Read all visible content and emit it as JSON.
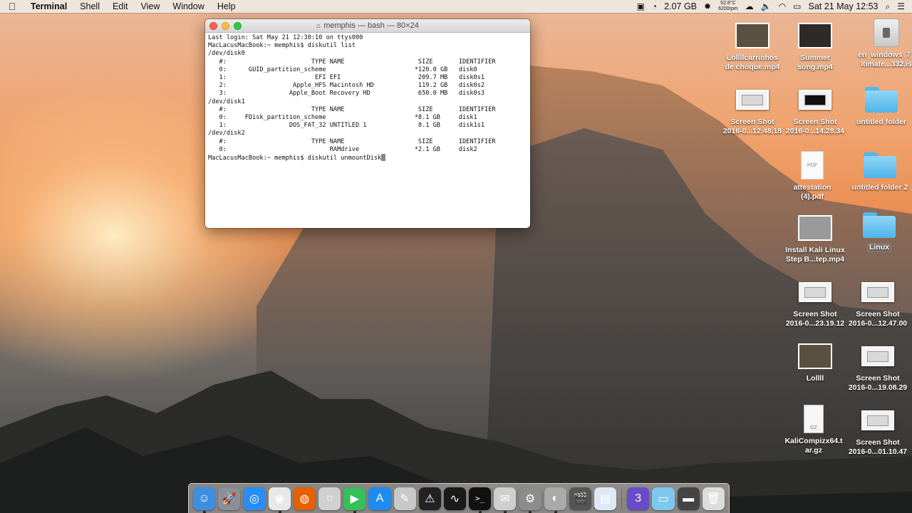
{
  "menubar": {
    "apple_icon": "apple-logo-icon",
    "app_name": "Terminal",
    "items": [
      "Shell",
      "Edit",
      "View",
      "Window",
      "Help"
    ],
    "memory": "2.07 GB",
    "temp_top": "52.8°C",
    "temp_bottom": "6200rpm",
    "date_time": "Sat 21 May  12:53"
  },
  "terminal": {
    "title": "memphis — bash — 80×24",
    "lines": [
      "Last login: Sat May 21 12:30:10 on ttys000",
      "MacLacusMacBook:~ memphis$ diskutil list",
      "/dev/disk0",
      "   #:                       TYPE NAME                    SIZE       IDENTIFIER",
      "   0:      GUID_partition_scheme                        *120.0 GB   disk0",
      "   1:                        EFI EFI                     209.7 MB   disk0s1",
      "   2:                  Apple_HFS Macintosh HD            119.2 GB   disk0s2",
      "   3:                 Apple_Boot Recovery HD             650.0 MB   disk0s3",
      "/dev/disk1",
      "   #:                       TYPE NAME                    SIZE       IDENTIFIER",
      "   0:     FDisk_partition_scheme                        *8.1 GB     disk1",
      "   1:                 DOS_FAT_32 UNTITLED 1              8.1 GB     disk1s1",
      "/dev/disk2",
      "   #:                       TYPE NAME                    SIZE       IDENTIFIER",
      "   0:                            RAMdrive               *2.1 GB     disk2"
    ],
    "prompt_line": "MacLacusMacBook:~ memphis$ diskutil unmountDisk"
  },
  "desktop_icons": [
    {
      "label": "Lollllcarrinhos\nde choque.mp4",
      "kind": "video"
    },
    {
      "label": "Summer\nsong.mp4",
      "kind": "video-dark"
    },
    {
      "label": "en_windows_7_\nltimate...332.is",
      "kind": "disk"
    },
    {
      "label": "Screen Shot\n2016-0...12.48.18",
      "kind": "shot"
    },
    {
      "label": "Screen Shot\n2016-0...14.28.34",
      "kind": "shot-dark"
    },
    {
      "label": "untitled folder",
      "kind": "folder"
    },
    {
      "label": "attestation\n(4).pdf",
      "kind": "pdf"
    },
    {
      "label": "untitled folder 2",
      "kind": "folder"
    },
    {
      "label": "Install Kali Linux\nStep B...tep.mp4",
      "kind": "video-dark"
    },
    {
      "label": "Linux",
      "kind": "folder"
    },
    {
      "label": "Screen Shot\n2016-0...23.19.12",
      "kind": "shot"
    },
    {
      "label": "Screen Shot\n2016-0...12.47.00",
      "kind": "shot"
    },
    {
      "label": "Lollll",
      "kind": "video"
    },
    {
      "label": "Screen Shot\n2016-0...19.08.29",
      "kind": "shot"
    },
    {
      "label": "KaliCompizx64.t\nar.gz",
      "kind": "gz"
    },
    {
      "label": "Screen Shot\n2016-0...01.10.47",
      "kind": "shot"
    }
  ],
  "pdf_badge": "PDF",
  "gz_badge": "GZ",
  "dock": {
    "apps": [
      {
        "name": "finder-icon",
        "color": "#3d8fe0",
        "glyph": "☺"
      },
      {
        "name": "launchpad-icon",
        "color": "#8a8f98",
        "glyph": "🚀"
      },
      {
        "name": "safari-icon",
        "color": "#2a8df2",
        "glyph": "◎"
      },
      {
        "name": "chrome-icon",
        "color": "#e8e8e8",
        "glyph": "◉"
      },
      {
        "name": "firefox-icon",
        "color": "#e66000",
        "glyph": "◍"
      },
      {
        "name": "opera-icon",
        "color": "#d0d0d0",
        "glyph": "○"
      },
      {
        "name": "facetime-icon",
        "color": "#36c05a",
        "glyph": "▶"
      },
      {
        "name": "app-store-icon",
        "color": "#1e8cef",
        "glyph": "A"
      },
      {
        "name": "script-editor-icon",
        "color": "#c8c8c8",
        "glyph": "✎"
      },
      {
        "name": "console-icon",
        "color": "#222",
        "glyph": "⚠"
      },
      {
        "name": "activity-monitor-icon",
        "color": "#1a1a1a",
        "glyph": "∿"
      },
      {
        "name": "terminal-icon",
        "color": "#111",
        "glyph": ">_"
      },
      {
        "name": "preview-icon",
        "color": "#cfcfcf",
        "glyph": "✉"
      },
      {
        "name": "system-preferences-icon",
        "color": "#8c8c8c",
        "glyph": "⚙"
      },
      {
        "name": "disk-utility-icon",
        "color": "#aaa",
        "glyph": "◐"
      },
      {
        "name": "video-icon",
        "color": "#555",
        "glyph": "🎬"
      },
      {
        "name": "document-icon",
        "color": "#dfe8f5",
        "glyph": "▤"
      },
      {
        "name": "mail-icon",
        "color": "#6a4cc9",
        "glyph": "3"
      },
      {
        "name": "downloads-folder-icon",
        "color": "#7ec8ef",
        "glyph": "▭"
      },
      {
        "name": "screen-icon",
        "color": "#444",
        "glyph": "▬"
      },
      {
        "name": "trash-icon",
        "color": "#dcdcdc",
        "glyph": "🗑"
      }
    ]
  }
}
